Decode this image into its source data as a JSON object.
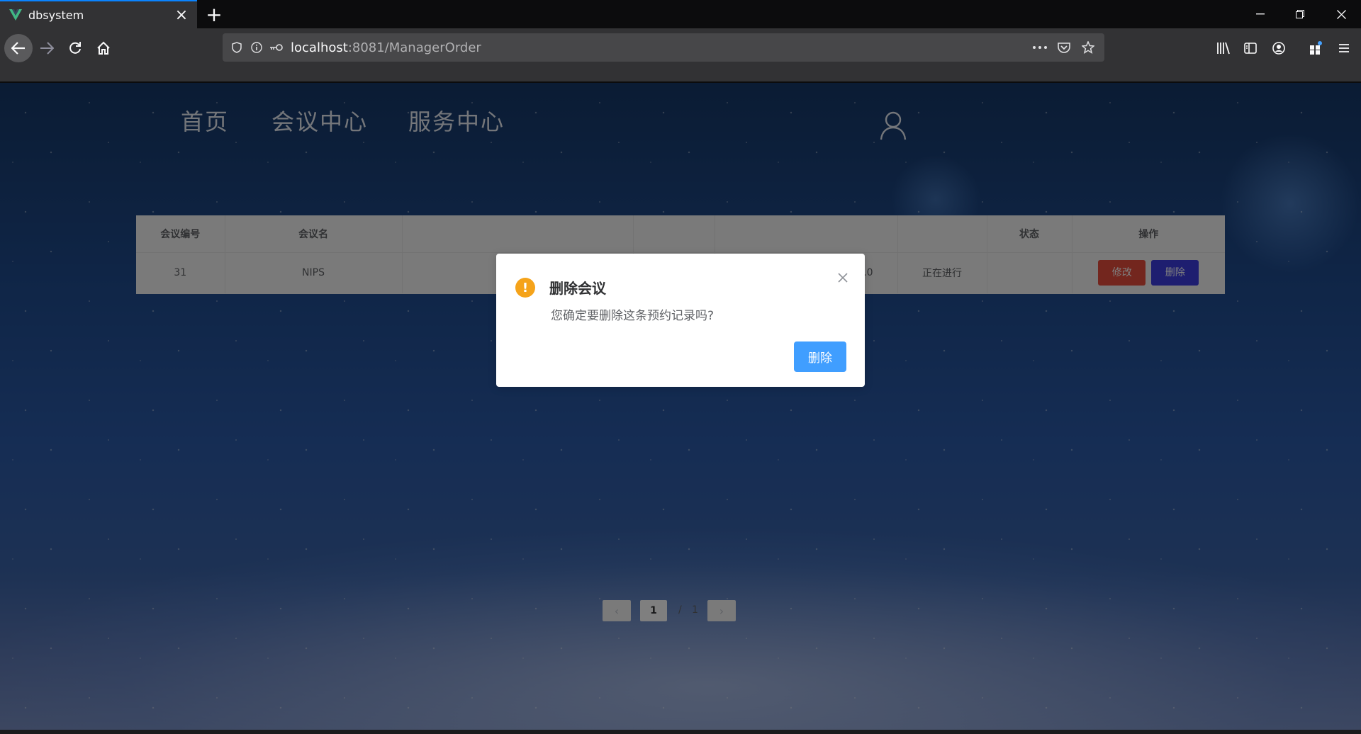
{
  "browser": {
    "tab_title": "dbsystem",
    "url_host": "localhost",
    "url_rest": ":8081/ManagerOrder"
  },
  "site_nav": {
    "home": "首页",
    "meeting_center": "会议中心",
    "service_center": "服务中心"
  },
  "table": {
    "headers": [
      "会议编号",
      "会议名",
      "",
      "",
      "",
      "",
      "状态",
      "操作"
    ],
    "rows": [
      {
        "id": "31",
        "name": "NIPS",
        "time_partial": "5-16 16:00:00.0",
        "status": "正在进行",
        "edit_label": "修改",
        "delete_label": "删除"
      }
    ]
  },
  "pagination": {
    "current": "1",
    "separator": "/",
    "total": "1"
  },
  "modal": {
    "title": "删除会议",
    "message": "您确定要删除这条预约记录吗?",
    "confirm_label": "删除",
    "warning_icon_char": "!"
  },
  "colors": {
    "accent": "#409eff",
    "warning": "#f5a31a",
    "edit_button": "#e74c3c",
    "delete_button": "#3c3ce0"
  }
}
